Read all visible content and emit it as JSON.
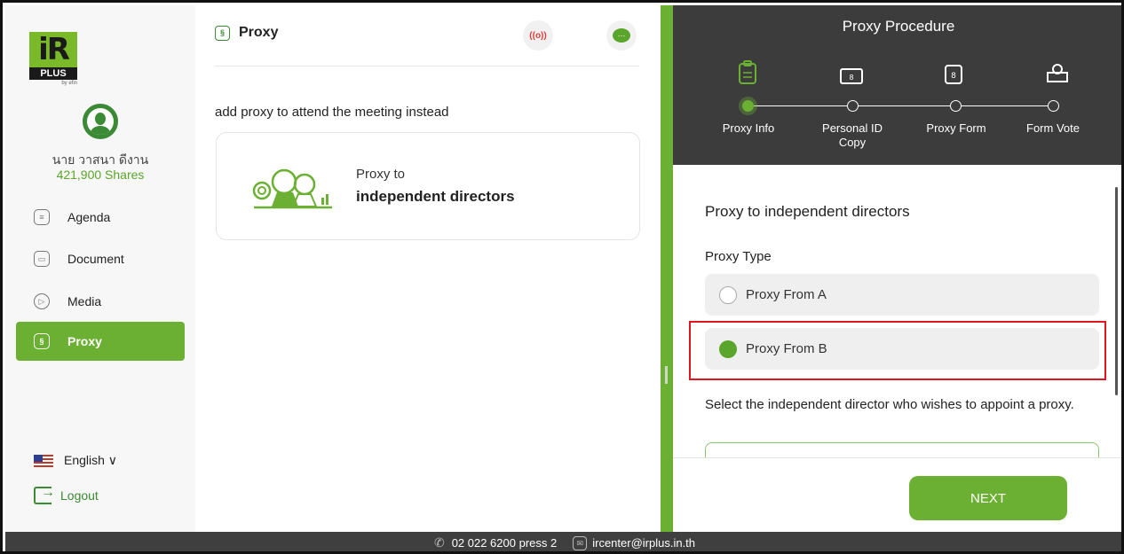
{
  "brand": {
    "logo_main": "iR",
    "logo_sub": "PLUS",
    "logo_by": "by efin"
  },
  "user": {
    "name": "นาย วาสนา ดีงาน",
    "shares": "421,900 Shares"
  },
  "sidebar": {
    "items": [
      {
        "label": "Agenda",
        "icon": "agenda-icon"
      },
      {
        "label": "Document",
        "icon": "document-icon"
      },
      {
        "label": "Media",
        "icon": "media-play-icon"
      },
      {
        "label": "Proxy",
        "icon": "proxy-icon",
        "active": true
      }
    ],
    "language": "English ∨",
    "logout": "Logout"
  },
  "middle": {
    "title": "Proxy",
    "live_label": "((o))",
    "subtitle": "add proxy to attend the meeting instead",
    "card": {
      "line1": "Proxy to",
      "line2": "independent directors"
    }
  },
  "procedure": {
    "title": "Proxy Procedure",
    "steps": [
      {
        "label": "Proxy Info",
        "icon": "clipboard-icon",
        "active": true
      },
      {
        "label": "Personal ID Copy",
        "icon": "id-card-icon"
      },
      {
        "label": "Proxy Form",
        "icon": "proxy-form-icon"
      },
      {
        "label": "Form Vote",
        "icon": "vote-box-icon"
      }
    ]
  },
  "form": {
    "title": "Proxy to independent directors",
    "type_label": "Proxy Type",
    "options": [
      {
        "label": "Proxy From A",
        "selected": false
      },
      {
        "label": "Proxy From B",
        "selected": true
      }
    ],
    "select_label": "Select the independent director who wishes to appoint a proxy.",
    "next": "NEXT"
  },
  "footer": {
    "phone": "02 022 6200 press 2",
    "email": "ircenter@irplus.in.th"
  },
  "colors": {
    "accent": "#6bb033",
    "dark_header": "#3c3c3c",
    "highlight": "#e1161e"
  }
}
